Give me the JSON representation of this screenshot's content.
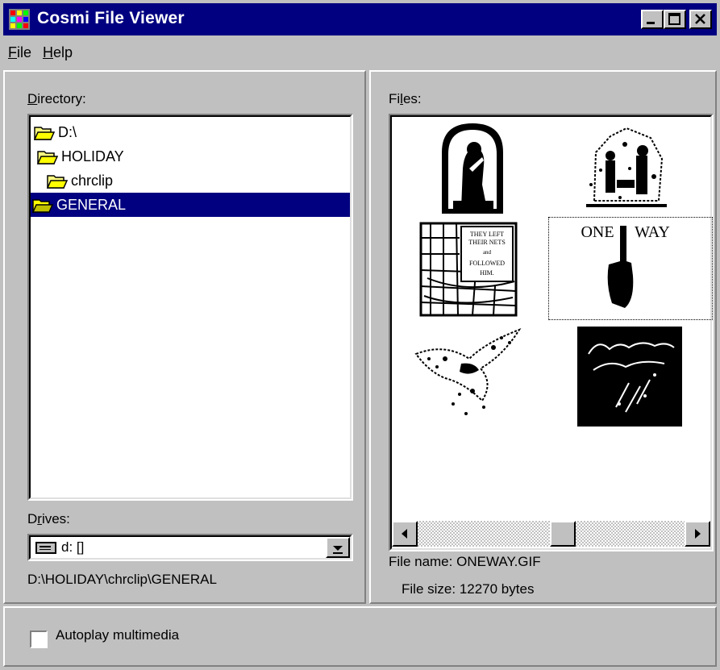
{
  "window": {
    "title": "Cosmi File Viewer"
  },
  "menu": {
    "file": {
      "accel": "F",
      "rest": "ile"
    },
    "help": {
      "accel": "H",
      "rest": "elp"
    }
  },
  "left": {
    "directory_label": {
      "accel": "D",
      "rest": "irectory:"
    },
    "directories": [
      {
        "label": "D:\\",
        "icon": "open-folder-icon"
      },
      {
        "label": "HOLIDAY",
        "icon": "open-folder-icon"
      },
      {
        "label": "chrclip",
        "icon": "open-folder-icon"
      },
      {
        "label": "GENERAL",
        "icon": "open-folder-icon",
        "selected": true
      }
    ],
    "drives_label": {
      "pre": "D",
      "accel": "r",
      "rest": "ives:"
    },
    "drive_value": "d: []",
    "current_path": "D:\\HOLIDAY\\chrclip\\GENERAL"
  },
  "right": {
    "files_label": {
      "pre": "Fi",
      "accel": "l",
      "rest": "es:"
    },
    "thumbnails": [
      {
        "name": "praying-figure-thumbnail"
      },
      {
        "name": "nativity-sketch-thumbnail"
      },
      {
        "name": "they-left-their-nets-thumbnail",
        "text": [
          "THEY LEFT",
          "THEIR NETS",
          "and",
          "FOLLOWED",
          "HIM."
        ]
      },
      {
        "name": "oneway-thumbnail",
        "text": [
          "ONE",
          "WAY"
        ],
        "selected": true
      },
      {
        "name": "dove-thumbnail"
      },
      {
        "name": "dark-script-thumbnail"
      }
    ],
    "file_name_label": "File name:",
    "file_name_value": "ONEWAY.GIF",
    "file_size_label": "File size:",
    "file_size_value": "12270 bytes"
  },
  "bottom": {
    "autoplay_label": "Autoplay multimedia",
    "autoplay_checked": false
  },
  "colors": {
    "titlebar": "#000080",
    "face": "#c0c0c0",
    "selection": "#000080"
  }
}
